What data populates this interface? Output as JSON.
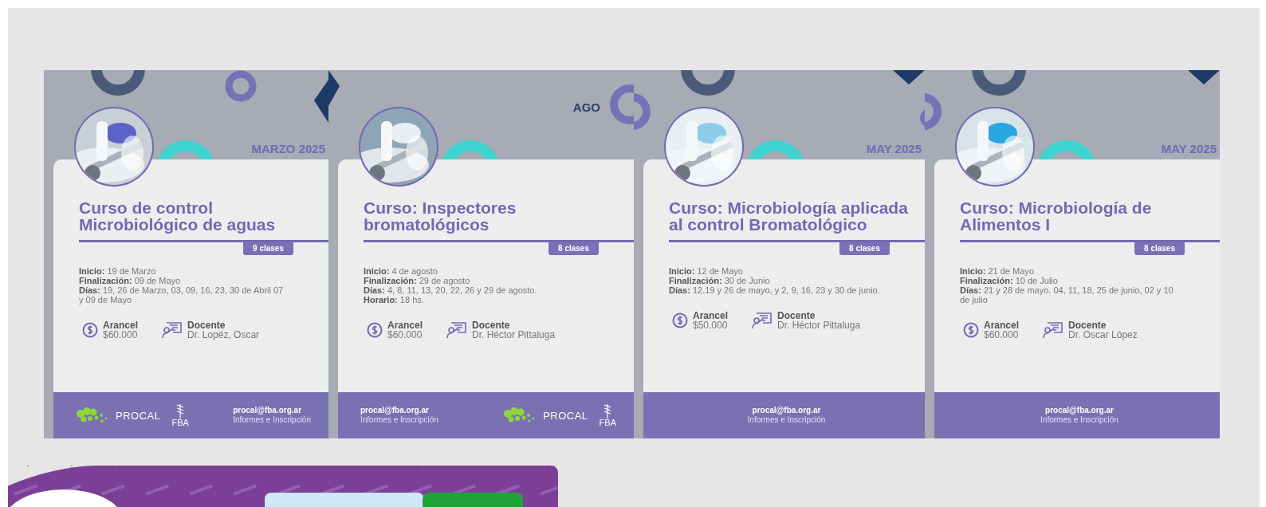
{
  "flyers": [
    {
      "kind": "low",
      "month": "MARZO 2025",
      "title": [
        "Curso de control",
        "Microbiológico de aguas"
      ],
      "badge": "9 clases",
      "details": [
        "**Inicio:** 19 de Marzo",
        "**Finalización:** 09 de Mayo",
        "**Días:** 19, 26 de Marzo, 03, 09, 16, 23, 30 de Abril 07 y 09 de Mayo"
      ],
      "fee_label": "Arancel",
      "fee": "$60.000",
      "teacher_label": "Docente",
      "teacher": "Dr. Lopéz, Oscar",
      "footer": {
        "kind": "logos-left",
        "procal": "PROCAL",
        "fba": "FBA",
        "email": "procal@fba.org.ar",
        "note": "Informes e Inscripción"
      }
    },
    {
      "kind": "high",
      "month": "AGO",
      "title": [
        "Curso: Inspectores",
        "bromatológicos"
      ],
      "badge": "8 clases",
      "details": [
        "**Inicio:** 4 de agosto",
        "**Finalización:** 29 de agosto",
        "**Días:** 4, 8, 11, 13, 20, 22, 26 y 29 de agosto.",
        "**Horario:** 18 hs."
      ],
      "fee_label": "Arancel",
      "fee": "$60.000",
      "teacher_label": "Docente",
      "teacher": "Dr.  Héctor Pittaluga",
      "footer": {
        "kind": "logos-right",
        "procal": "PROCAL",
        "fba": "FBA",
        "email": "procal@fba.org.ar",
        "note": "Informes e Inscripción"
      }
    },
    {
      "kind": "low",
      "month": "MAY 2025",
      "title": [
        "Curso: Microbiología aplicada",
        "al control Bromatológico"
      ],
      "badge": "8 clases",
      "details": [
        "**Inicio:** 12 de Mayo",
        "**Finalización:** 30 de Junio",
        "**Días:** 12.19 y 26 de mayo, y 2, 9, 16, 23 y 30 de junio."
      ],
      "fee_label": "Arancel",
      "fee": "$50.000",
      "teacher_label": "Docente",
      "teacher": "Dr. Héctor Pittaluga",
      "footer": {
        "kind": "centered",
        "email": "procal@fba.org.ar",
        "note": "Informes e Inscripción"
      }
    },
    {
      "kind": "low",
      "month": "MAY 2025",
      "title": [
        "Curso: Microbiología de",
        "Alimentos I"
      ],
      "badge": "8 clases",
      "details": [
        "**Inicio:** 21 de Mayo",
        "**Finalización:** 10 de Julio",
        "**Días:** 21 y 28 de mayo. 04, 11, 18, 25 de junio, 02 y 10 de julio"
      ],
      "fee_label": "Arancel",
      "fee": "$60.000",
      "teacher_label": "Docente",
      "teacher": "Dr. Oscar López",
      "footer": {
        "kind": "centered",
        "email": "procal@fba.org.ar",
        "note": "Informes e Inscripción"
      }
    }
  ]
}
